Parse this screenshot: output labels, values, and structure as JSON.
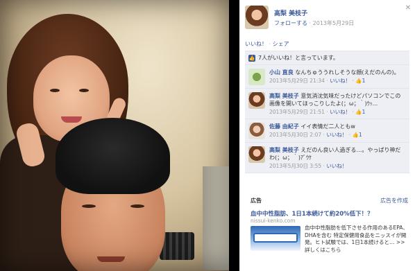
{
  "owner": {
    "name": "高梨 美枝子",
    "follow_label": "フォローする",
    "date": "2013年5月29日"
  },
  "actions": {
    "like_label": "いいね！",
    "separator": "·",
    "share_label": "シェア"
  },
  "likes_summary": "7人がいいね！と言っています。",
  "comments": [
    {
      "name": "小山 直良",
      "text": "なんちゅううれしそうな顔(えだのんの)。",
      "time": "2013年5月29日 21:34",
      "like_label": "いいね！",
      "like_count": "1"
    },
    {
      "name": "高梨 美枝子",
      "text": "意気消沈気味だったけどパソコンでこの画像を開いてほっこりしたよ(；ω；｀)ｳｯ...",
      "time": "2013年5月29日 21:51",
      "like_label": "いいね！",
      "like_count": "1"
    },
    {
      "name": "佐藤 由紀子",
      "text": "イイ表情だ二人ともw",
      "time": "2013年5月30日 2:07",
      "like_label": "いいね！",
      "like_count": "1"
    },
    {
      "name": "高梨 美枝子",
      "text": "えだのん良い人過ぎる…。やっぱり神だわ(；ω；｀)ｱﾞｳｹ",
      "time": "2013年5月30日 3:55",
      "like_label": "いいね！",
      "like_count": ""
    }
  ],
  "ad": {
    "label": "広告",
    "create_label": "広告を作成",
    "title": "血中中性脂肪、1日1本続けて約20%低下！？",
    "domain": "nissui-kenko.com",
    "text": "血中中性脂肪を低下させる作用のあるEPA、DHAを含む 特定保健用食品をニッスイが開発。ヒト試験では、1日1本続けると… >>詳しくはこちら"
  },
  "close_icon": "close-icon"
}
